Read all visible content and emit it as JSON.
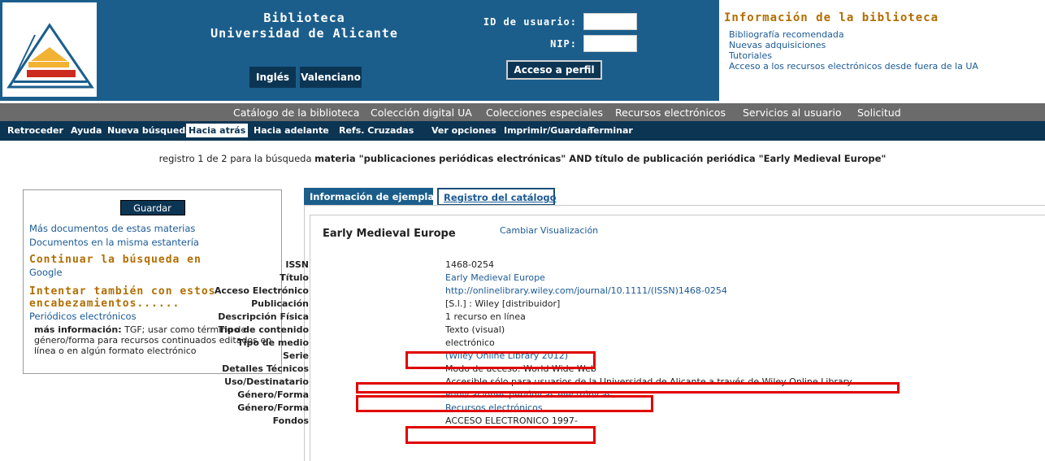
{
  "header": {
    "library_title_line1": "Biblioteca",
    "library_title_line2": "Universidad de Alicante",
    "lang_english": "Inglés",
    "lang_valencian": "Valenciano",
    "user_id_label": "ID de usuario:",
    "nip_label": "NIP:",
    "user_id_value": "",
    "nip_value": "",
    "profile_button": "Acceso a perfil",
    "info_title": "Información de la biblioteca",
    "info_links": [
      "Bibliografía recomendada",
      "Nuevas adquisiciones",
      "Tutoriales",
      "Acceso a los recursos electrónicos desde fuera de la UA"
    ]
  },
  "main_nav": [
    "Catálogo de la biblioteca",
    "Colección digital UA",
    "Colecciones especiales",
    "Recursos electrónicos",
    "Servicios al usuario",
    "Solicitud"
  ],
  "toolbar": [
    "Retroceder",
    "Ayuda",
    "Nueva búsqueda",
    "Hacia atrás",
    "Hacia adelante",
    "Refs. Cruzadas",
    "Ver opciones",
    "Imprimir/Guardar",
    "Terminar"
  ],
  "toolbar_active": "Hacia atrás",
  "search_info": {
    "prefix": "registro 1 de 2 para la búsqueda",
    "query": "materia \"publicaciones periódicas electrónicas\" AND título de publicación periódica \"Early Medieval Europe\""
  },
  "left_panel": {
    "save_button": "Guardar",
    "links": [
      "Más documentos de estas materias",
      "Documentos en la misma estantería"
    ],
    "continue_heading": "Continuar la búsqueda en",
    "continue_link": "Google",
    "try_heading_line1": "Intentar también con estos",
    "try_heading_line2": "encabezamientos......",
    "try_link": "Periódicos electrónicos",
    "more_info_label": "más información:",
    "more_info_text": "TGF; usar como término de género/forma para recursos continuados editados en línea o en algún formato electrónico"
  },
  "tabs": {
    "items_tab": "Información de ejemplar",
    "catalog_tab": "Registro del catálogo"
  },
  "record": {
    "title": "Early Medieval Europe",
    "change_view": "Cambiar Visualización",
    "fields": [
      {
        "label": "ISSN",
        "value": "1468-0254"
      },
      {
        "label": "Título",
        "value": "Early Medieval Europe"
      },
      {
        "label": "Acceso Electrónico",
        "value": "http://onlinelibrary.wiley.com/journal/10.1111/(ISSN)1468-0254"
      },
      {
        "label": "Publicación",
        "value": "[S.l.] : Wiley [distribuidor]"
      },
      {
        "label": "Descripción Física",
        "value": "1 recurso en línea"
      },
      {
        "label": "Tipo de contenido",
        "value": "Texto (visual)"
      },
      {
        "label": "Tipo de medio",
        "value": "electrónico"
      },
      {
        "label": "Serie",
        "value": "(Wiley Online Library 2012)"
      },
      {
        "label": "Detalles Técnicos",
        "value": "Modo de acceso: World Wide Web"
      },
      {
        "label": "Uso/Destinatario",
        "value": "Accesible sólo para usuarios de la Universidad de Alicante a través de Wiley Online Library"
      },
      {
        "label": "Género/Forma",
        "value": "Publicaciones periódicas electrónicas"
      },
      {
        "label": "Género/Forma",
        "value": "Recursos electrónicos"
      },
      {
        "label": "Fondos",
        "value": "ACCESO ELECTRONICO 1997-"
      }
    ]
  },
  "colors": {
    "header_blue": "#1b5e8c",
    "dark_blue": "#0c3554",
    "nav_gray": "#6b6b6b",
    "heading_orange": "#b26d00",
    "link_blue": "#1a5a95",
    "highlight_red": "#e00000"
  }
}
